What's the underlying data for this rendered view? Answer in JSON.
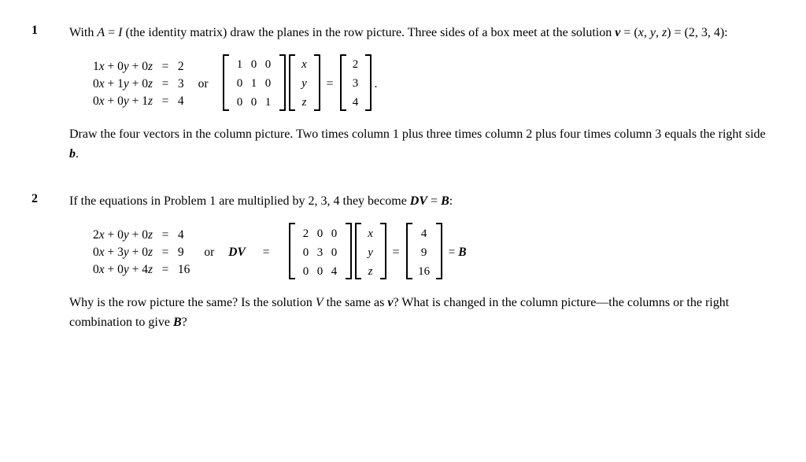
{
  "problems": [
    {
      "number": "1",
      "intro": "With A = I (the identity matrix) draw the planes in the row picture. Three sides of a box meet at the solution v = (x, y, z) = (2, 3, 4):",
      "system": [
        "1x + 0y + 0z = 2",
        "0x + 1y + 0z = 3",
        "0x + 0y + 1z = 4"
      ],
      "matrix_A": [
        [
          "1",
          "0",
          "0"
        ],
        [
          "0",
          "1",
          "0"
        ],
        [
          "0",
          "0",
          "1"
        ]
      ],
      "vector_v": [
        "x",
        "y",
        "z"
      ],
      "vector_b": [
        "2",
        "3",
        "4"
      ],
      "follow_text": "Draw the four vectors in the column picture. Two times column 1 plus three times column 2 plus four times column 3 equals the right side b.",
      "or_label": "or"
    },
    {
      "number": "2",
      "intro": "If the equations in Problem 1 are multiplied by 2, 3, 4 they become DV = B:",
      "system": [
        "2x + 0y + 0z =  4",
        "0x + 3y + 0z =  9",
        "0x + 0y + 4z = 16"
      ],
      "dv_label": "DV =",
      "matrix_A": [
        [
          "2",
          "0",
          "0"
        ],
        [
          "0",
          "3",
          "0"
        ],
        [
          "0",
          "0",
          "4"
        ]
      ],
      "vector_v": [
        "x",
        "y",
        "z"
      ],
      "vector_b": [
        "4",
        "9",
        "16"
      ],
      "b_label": "= B",
      "or_label": "or",
      "follow_text": "Why is the row picture the same? Is the solution V the same as v? What is changed in the column picture—the columns or the right combination to give B?"
    }
  ]
}
